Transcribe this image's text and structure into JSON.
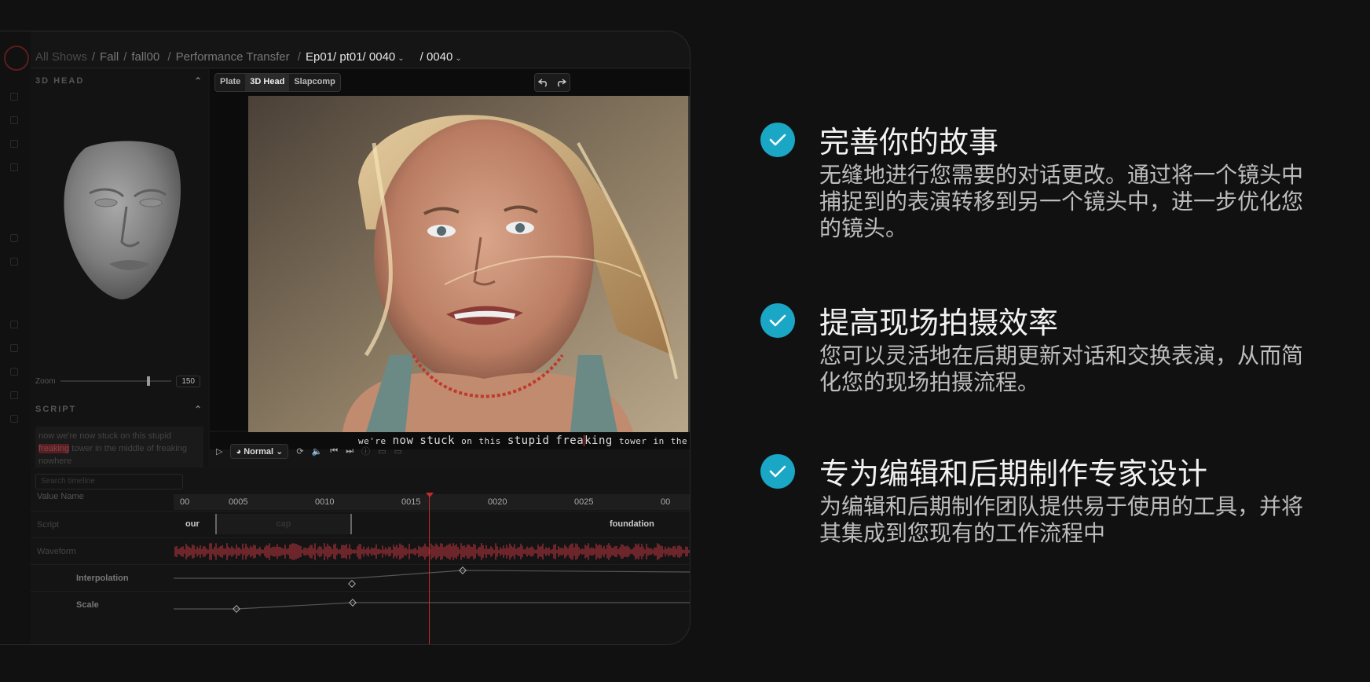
{
  "breadcrumb": {
    "items": [
      "All Shows",
      "Fall",
      "fall00",
      "Performance Transfer"
    ],
    "episode": "Ep01/ pt01/ 0040",
    "shot": "/ 0040"
  },
  "head_panel": {
    "title": "3D HEAD",
    "zoom_label": "Zoom",
    "zoom_value": "150"
  },
  "script_panel": {
    "title": "SCRIPT",
    "text_before": "now we're now stuck on this stupid",
    "highlight": "freaking",
    "text_after": "tower in the middle of",
    "text_after2": "freaking nowhere"
  },
  "viewer": {
    "tabs": [
      "Plate",
      "3D Head",
      "Slapcomp"
    ],
    "subtitle": [
      "we're",
      "now",
      "stuck",
      "on",
      "this",
      "stupid",
      "frea",
      "king",
      "tower",
      "in",
      "the"
    ]
  },
  "controls": {
    "speed": "Normal"
  },
  "timeline": {
    "search_placeholder": "Search timeline",
    "col_header": "Value Name",
    "ruler_ticks": [
      "00",
      "0005",
      "0010",
      "0015",
      "0020",
      "0025",
      "00"
    ],
    "rows": [
      {
        "label": "Script"
      },
      {
        "label": "Waveform"
      },
      {
        "label": "Interpolation"
      },
      {
        "label": "Scale"
      }
    ],
    "script_words": [
      "our",
      "cap",
      "foundation"
    ]
  },
  "features": [
    {
      "title": "完善你的故事",
      "desc": "无缝地进行您需要的对话更改。通过将一个镜头中捕捉到的表演转移到另一个镜头中，进一步优化您的镜头。"
    },
    {
      "title": "提高现场拍摄效率",
      "desc": "您可以灵活地在后期更新对话和交换表演，从而简化您的现场拍摄流程。"
    },
    {
      "title": "专为编辑和后期制作专家设计",
      "desc": "为编辑和后期制作团队提供易于使用的工具，并将其集成到您现有的工作流程中"
    }
  ],
  "colors": {
    "accent": "#1aa7c6",
    "playhead": "#c62b2b",
    "background": "#111112"
  }
}
